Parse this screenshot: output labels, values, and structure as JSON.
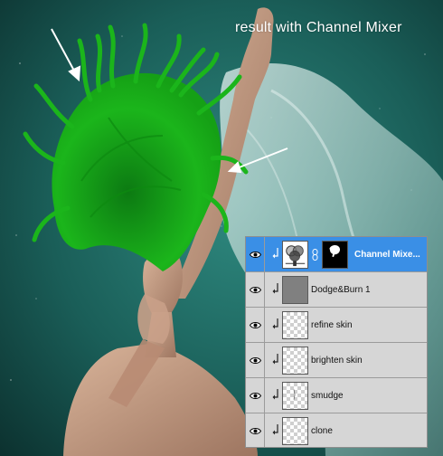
{
  "caption": "result with Channel Mixer",
  "colors": {
    "panel_bg": "#d6d6d6",
    "selected_row": "#3a8fe6",
    "hair": "#1bb51b",
    "background": "#1b6a63"
  },
  "layers_panel": {
    "layers": [
      {
        "name": "Channel Mixe...",
        "selected": true,
        "type": "adjustment",
        "visible": true
      },
      {
        "name": "Dodge&Burn 1",
        "selected": false,
        "type": "gray",
        "visible": true
      },
      {
        "name": "refine skin",
        "selected": false,
        "type": "transparent",
        "visible": true
      },
      {
        "name": "brighten skin",
        "selected": false,
        "type": "transparent",
        "visible": true
      },
      {
        "name": "smudge",
        "selected": false,
        "type": "transparent",
        "visible": true
      },
      {
        "name": "clone",
        "selected": false,
        "type": "transparent",
        "visible": true
      }
    ]
  },
  "icons": [
    "eye-icon",
    "clip-arrow-icon",
    "chain-link-icon",
    "channel-mixer-icon",
    "arrow-annotation"
  ]
}
